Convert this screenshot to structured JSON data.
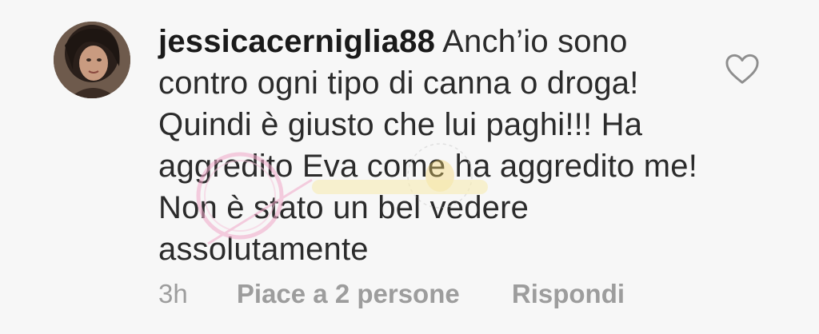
{
  "comment": {
    "username": "jessicacerniglia88",
    "text": "Anch’io sono contro ogni tipo di canna o droga! Quindi è giusto che lui paghi!!! Ha aggredito Eva come ha aggredito me! Non è stato un bel vedere assolutamente",
    "time": "3h",
    "likes_label": "Piace a 2 persone",
    "reply_label": "Rispondi"
  },
  "icons": {
    "like": "heart-outline-icon",
    "avatar": "user-avatar"
  },
  "colors": {
    "background": "#f7f7f7",
    "text": "#2b2b2b",
    "meta": "#9d9d9d",
    "heart_stroke": "#8e8e8e"
  }
}
